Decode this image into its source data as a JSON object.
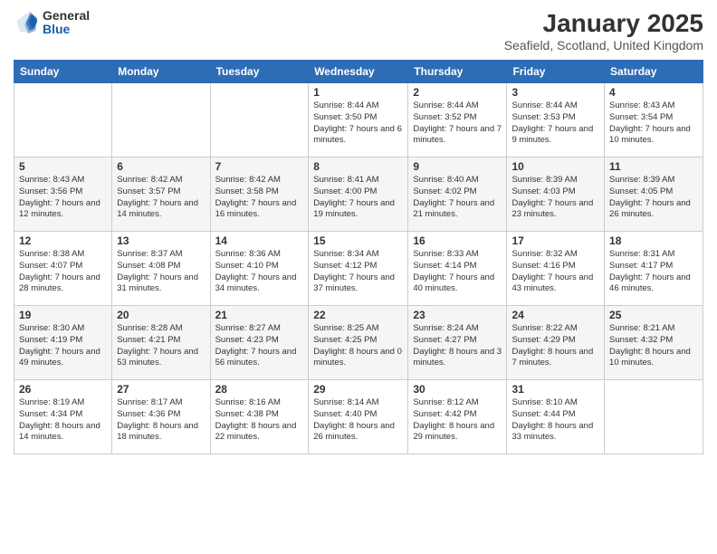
{
  "logo": {
    "general": "General",
    "blue": "Blue"
  },
  "title": "January 2025",
  "location": "Seafield, Scotland, United Kingdom",
  "days_of_week": [
    "Sunday",
    "Monday",
    "Tuesday",
    "Wednesday",
    "Thursday",
    "Friday",
    "Saturday"
  ],
  "weeks": [
    [
      {
        "day": "",
        "info": ""
      },
      {
        "day": "",
        "info": ""
      },
      {
        "day": "",
        "info": ""
      },
      {
        "day": "1",
        "info": "Sunrise: 8:44 AM\nSunset: 3:50 PM\nDaylight: 7 hours and 6 minutes."
      },
      {
        "day": "2",
        "info": "Sunrise: 8:44 AM\nSunset: 3:52 PM\nDaylight: 7 hours and 7 minutes."
      },
      {
        "day": "3",
        "info": "Sunrise: 8:44 AM\nSunset: 3:53 PM\nDaylight: 7 hours and 9 minutes."
      },
      {
        "day": "4",
        "info": "Sunrise: 8:43 AM\nSunset: 3:54 PM\nDaylight: 7 hours and 10 minutes."
      }
    ],
    [
      {
        "day": "5",
        "info": "Sunrise: 8:43 AM\nSunset: 3:56 PM\nDaylight: 7 hours and 12 minutes."
      },
      {
        "day": "6",
        "info": "Sunrise: 8:42 AM\nSunset: 3:57 PM\nDaylight: 7 hours and 14 minutes."
      },
      {
        "day": "7",
        "info": "Sunrise: 8:42 AM\nSunset: 3:58 PM\nDaylight: 7 hours and 16 minutes."
      },
      {
        "day": "8",
        "info": "Sunrise: 8:41 AM\nSunset: 4:00 PM\nDaylight: 7 hours and 19 minutes."
      },
      {
        "day": "9",
        "info": "Sunrise: 8:40 AM\nSunset: 4:02 PM\nDaylight: 7 hours and 21 minutes."
      },
      {
        "day": "10",
        "info": "Sunrise: 8:39 AM\nSunset: 4:03 PM\nDaylight: 7 hours and 23 minutes."
      },
      {
        "day": "11",
        "info": "Sunrise: 8:39 AM\nSunset: 4:05 PM\nDaylight: 7 hours and 26 minutes."
      }
    ],
    [
      {
        "day": "12",
        "info": "Sunrise: 8:38 AM\nSunset: 4:07 PM\nDaylight: 7 hours and 28 minutes."
      },
      {
        "day": "13",
        "info": "Sunrise: 8:37 AM\nSunset: 4:08 PM\nDaylight: 7 hours and 31 minutes."
      },
      {
        "day": "14",
        "info": "Sunrise: 8:36 AM\nSunset: 4:10 PM\nDaylight: 7 hours and 34 minutes."
      },
      {
        "day": "15",
        "info": "Sunrise: 8:34 AM\nSunset: 4:12 PM\nDaylight: 7 hours and 37 minutes."
      },
      {
        "day": "16",
        "info": "Sunrise: 8:33 AM\nSunset: 4:14 PM\nDaylight: 7 hours and 40 minutes."
      },
      {
        "day": "17",
        "info": "Sunrise: 8:32 AM\nSunset: 4:16 PM\nDaylight: 7 hours and 43 minutes."
      },
      {
        "day": "18",
        "info": "Sunrise: 8:31 AM\nSunset: 4:17 PM\nDaylight: 7 hours and 46 minutes."
      }
    ],
    [
      {
        "day": "19",
        "info": "Sunrise: 8:30 AM\nSunset: 4:19 PM\nDaylight: 7 hours and 49 minutes."
      },
      {
        "day": "20",
        "info": "Sunrise: 8:28 AM\nSunset: 4:21 PM\nDaylight: 7 hours and 53 minutes."
      },
      {
        "day": "21",
        "info": "Sunrise: 8:27 AM\nSunset: 4:23 PM\nDaylight: 7 hours and 56 minutes."
      },
      {
        "day": "22",
        "info": "Sunrise: 8:25 AM\nSunset: 4:25 PM\nDaylight: 8 hours and 0 minutes."
      },
      {
        "day": "23",
        "info": "Sunrise: 8:24 AM\nSunset: 4:27 PM\nDaylight: 8 hours and 3 minutes."
      },
      {
        "day": "24",
        "info": "Sunrise: 8:22 AM\nSunset: 4:29 PM\nDaylight: 8 hours and 7 minutes."
      },
      {
        "day": "25",
        "info": "Sunrise: 8:21 AM\nSunset: 4:32 PM\nDaylight: 8 hours and 10 minutes."
      }
    ],
    [
      {
        "day": "26",
        "info": "Sunrise: 8:19 AM\nSunset: 4:34 PM\nDaylight: 8 hours and 14 minutes."
      },
      {
        "day": "27",
        "info": "Sunrise: 8:17 AM\nSunset: 4:36 PM\nDaylight: 8 hours and 18 minutes."
      },
      {
        "day": "28",
        "info": "Sunrise: 8:16 AM\nSunset: 4:38 PM\nDaylight: 8 hours and 22 minutes."
      },
      {
        "day": "29",
        "info": "Sunrise: 8:14 AM\nSunset: 4:40 PM\nDaylight: 8 hours and 26 minutes."
      },
      {
        "day": "30",
        "info": "Sunrise: 8:12 AM\nSunset: 4:42 PM\nDaylight: 8 hours and 29 minutes."
      },
      {
        "day": "31",
        "info": "Sunrise: 8:10 AM\nSunset: 4:44 PM\nDaylight: 8 hours and 33 minutes."
      },
      {
        "day": "",
        "info": ""
      }
    ]
  ]
}
